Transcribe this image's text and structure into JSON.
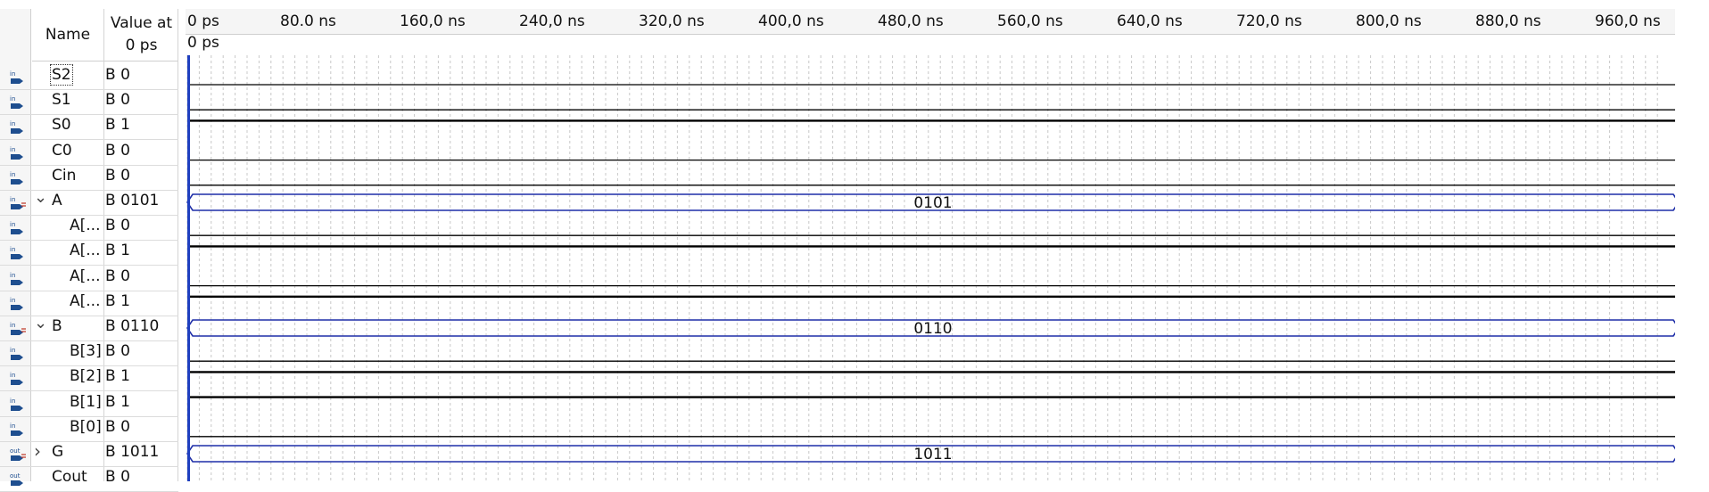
{
  "header": {
    "name_label": "Name",
    "value_label_line1": "Value at",
    "value_label_line2": "0 ps",
    "cursor_label": "0 ps"
  },
  "time_ticks": [
    "0 ps",
    "80.0 ns",
    "160,0 ns",
    "240,0 ns",
    "320,0 ns",
    "400,0 ns",
    "480,0 ns",
    "560,0 ns",
    "640,0 ns",
    "720,0 ns",
    "800,0 ns",
    "880,0 ns",
    "960,0 ns"
  ],
  "colors": {
    "wave": "#000000",
    "bus": "#1f2fa8",
    "cursor": "#1f3fbf",
    "grid": "#c8c8c8",
    "icon_in": "#1e4e8f",
    "icon_out": "#1e4e8f"
  },
  "signals": [
    {
      "name": "S2",
      "value": "B 0",
      "icon": "input-pin-icon",
      "indent": 0,
      "type": "bit",
      "level": 0,
      "selected": true
    },
    {
      "name": "S1",
      "value": "B 0",
      "icon": "input-pin-icon",
      "indent": 0,
      "type": "bit",
      "level": 0
    },
    {
      "name": "S0",
      "value": "B 1",
      "icon": "input-pin-icon",
      "indent": 0,
      "type": "bit",
      "level": 1
    },
    {
      "name": "C0",
      "value": "B 0",
      "icon": "input-pin-icon",
      "indent": 0,
      "type": "bit",
      "level": 0
    },
    {
      "name": "Cin",
      "value": "B 0",
      "icon": "input-pin-icon",
      "indent": 0,
      "type": "bit",
      "level": 0
    },
    {
      "name": "A",
      "value": "B 0101",
      "icon": "input-bus-icon",
      "indent": 0,
      "type": "bus",
      "expand": "expanded",
      "bus_value": "0101"
    },
    {
      "name": "A[...",
      "value": "B 0",
      "icon": "input-pin-icon",
      "indent": 1,
      "type": "bit",
      "level": 0
    },
    {
      "name": "A[...",
      "value": "B 1",
      "icon": "input-pin-icon",
      "indent": 1,
      "type": "bit",
      "level": 1
    },
    {
      "name": "A[...",
      "value": "B 0",
      "icon": "input-pin-icon",
      "indent": 1,
      "type": "bit",
      "level": 0
    },
    {
      "name": "A[...",
      "value": "B 1",
      "icon": "input-pin-icon",
      "indent": 1,
      "type": "bit",
      "level": 1
    },
    {
      "name": "B",
      "value": "B 0110",
      "icon": "input-bus-icon",
      "indent": 0,
      "type": "bus",
      "expand": "expanded",
      "bus_value": "0110"
    },
    {
      "name": "B[3]",
      "value": "B 0",
      "icon": "input-pin-icon",
      "indent": 1,
      "type": "bit",
      "level": 0
    },
    {
      "name": "B[2]",
      "value": "B 1",
      "icon": "input-pin-icon",
      "indent": 1,
      "type": "bit",
      "level": 1
    },
    {
      "name": "B[1]",
      "value": "B 1",
      "icon": "input-pin-icon",
      "indent": 1,
      "type": "bit",
      "level": 1
    },
    {
      "name": "B[0]",
      "value": "B 0",
      "icon": "input-pin-icon",
      "indent": 1,
      "type": "bit",
      "level": 0
    },
    {
      "name": "G",
      "value": "B 1011",
      "icon": "output-bus-icon",
      "indent": 0,
      "type": "bus",
      "expand": "collapsed",
      "bus_value": "1011"
    },
    {
      "name": "Cout",
      "value": "B 0",
      "icon": "output-pin-icon",
      "indent": 0,
      "type": "bit",
      "level": 0
    }
  ]
}
